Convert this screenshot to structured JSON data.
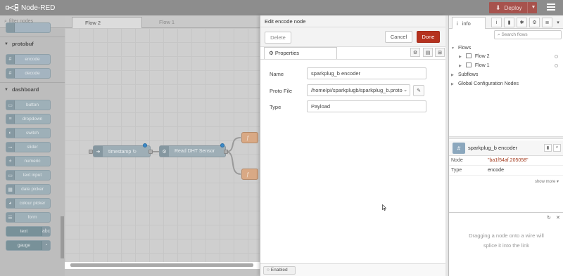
{
  "header": {
    "app_title": "Node-RED",
    "deploy_label": "Deploy"
  },
  "palette": {
    "filter_placeholder": "filter nodes",
    "categories": [
      {
        "name": "protobuf",
        "nodes": [
          "encode",
          "decode"
        ]
      },
      {
        "name": "dashboard",
        "nodes": [
          "button",
          "dropdown",
          "switch",
          "slider",
          "numeric",
          "text input",
          "date picker",
          "colour picker",
          "form",
          "text",
          "gauge"
        ]
      }
    ]
  },
  "workspace": {
    "tabs": [
      "Flow 2",
      "Flow 1"
    ],
    "nodes": [
      "timestamp ↻",
      "Read DHT Sensor"
    ]
  },
  "tray": {
    "title": "Edit encode node",
    "delete_label": "Delete",
    "cancel_label": "Cancel",
    "done_label": "Done",
    "properties_tab": "Properties",
    "fields": {
      "name_label": "Name",
      "name_value": "sparkplug_b encoder",
      "proto_label": "Proto File",
      "proto_value": "/home/pi/sparkplugb/sparkplug_b.proto",
      "type_label": "Type",
      "type_value": "Payload"
    },
    "enabled_label": "Enabled"
  },
  "sidebar": {
    "info_tab": "info",
    "search_placeholder": "Search flows",
    "tree": {
      "flows_label": "Flows",
      "flow_items": [
        "Flow 2",
        "Flow 1"
      ],
      "subflows_label": "Subflows",
      "global_label": "Global Configuration Nodes"
    },
    "node_info": {
      "name": "sparkplug_b encoder",
      "rows": [
        {
          "key": "Node",
          "value": "\"ba1f54af.205058\""
        },
        {
          "key": "Type",
          "value": "encode"
        }
      ],
      "show_more": "show more ▾"
    },
    "help_text_1": "Dragging a node onto a wire will",
    "help_text_2": "splice it into the link"
  }
}
